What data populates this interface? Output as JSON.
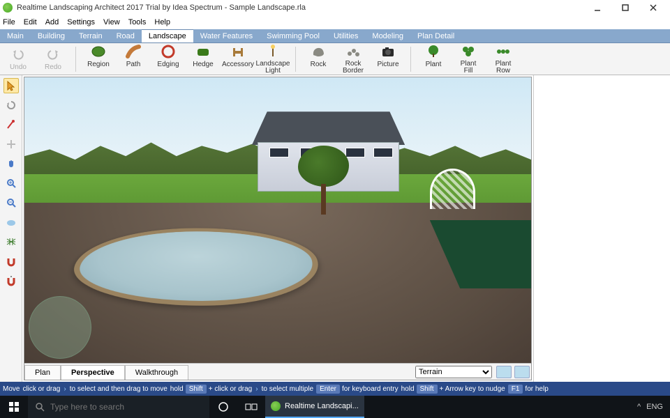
{
  "titlebar": {
    "text": "Realtime Landscaping Architect 2017 Trial by Idea Spectrum - Sample Landscape.rla"
  },
  "menu": {
    "items": [
      "File",
      "Edit",
      "Add",
      "Settings",
      "View",
      "Tools",
      "Help"
    ]
  },
  "ribbonTabs": [
    "Main",
    "Building",
    "Terrain",
    "Road",
    "Landscape",
    "Water Features",
    "Swimming Pool",
    "Utilities",
    "Modeling",
    "Plan Detail"
  ],
  "ribbonActive": "Landscape",
  "ribbon": {
    "undo": "Undo",
    "redo": "Redo",
    "region": "Region",
    "path": "Path",
    "edging": "Edging",
    "hedge": "Hedge",
    "accessory": "Accessory",
    "landscape_light": "Landscape\nLight",
    "rock": "Rock",
    "rock_border": "Rock\nBorder",
    "picture": "Picture",
    "plant": "Plant",
    "plant_fill": "Plant\nFill",
    "plant_row": "Plant\nRow"
  },
  "viewTabs": {
    "plan": "Plan",
    "perspective": "Perspective",
    "walkthrough": "Walkthrough"
  },
  "layerSelect": "Terrain",
  "status": {
    "move": "Move",
    "s1a": "click or drag",
    "s1b": "to select and then drag to move",
    "hold": "hold",
    "shift": "Shift",
    "plus": "+ click or drag",
    "s2b": "to select multiple",
    "enter": "Enter",
    "s3": "for keyboard entry",
    "s4": "+ Arrow key to nudge",
    "f1": "F1",
    "s5": "for help"
  },
  "taskbar": {
    "search_placeholder": "Type here to search",
    "app": "Realtime Landscapi...",
    "lang": "ENG"
  }
}
